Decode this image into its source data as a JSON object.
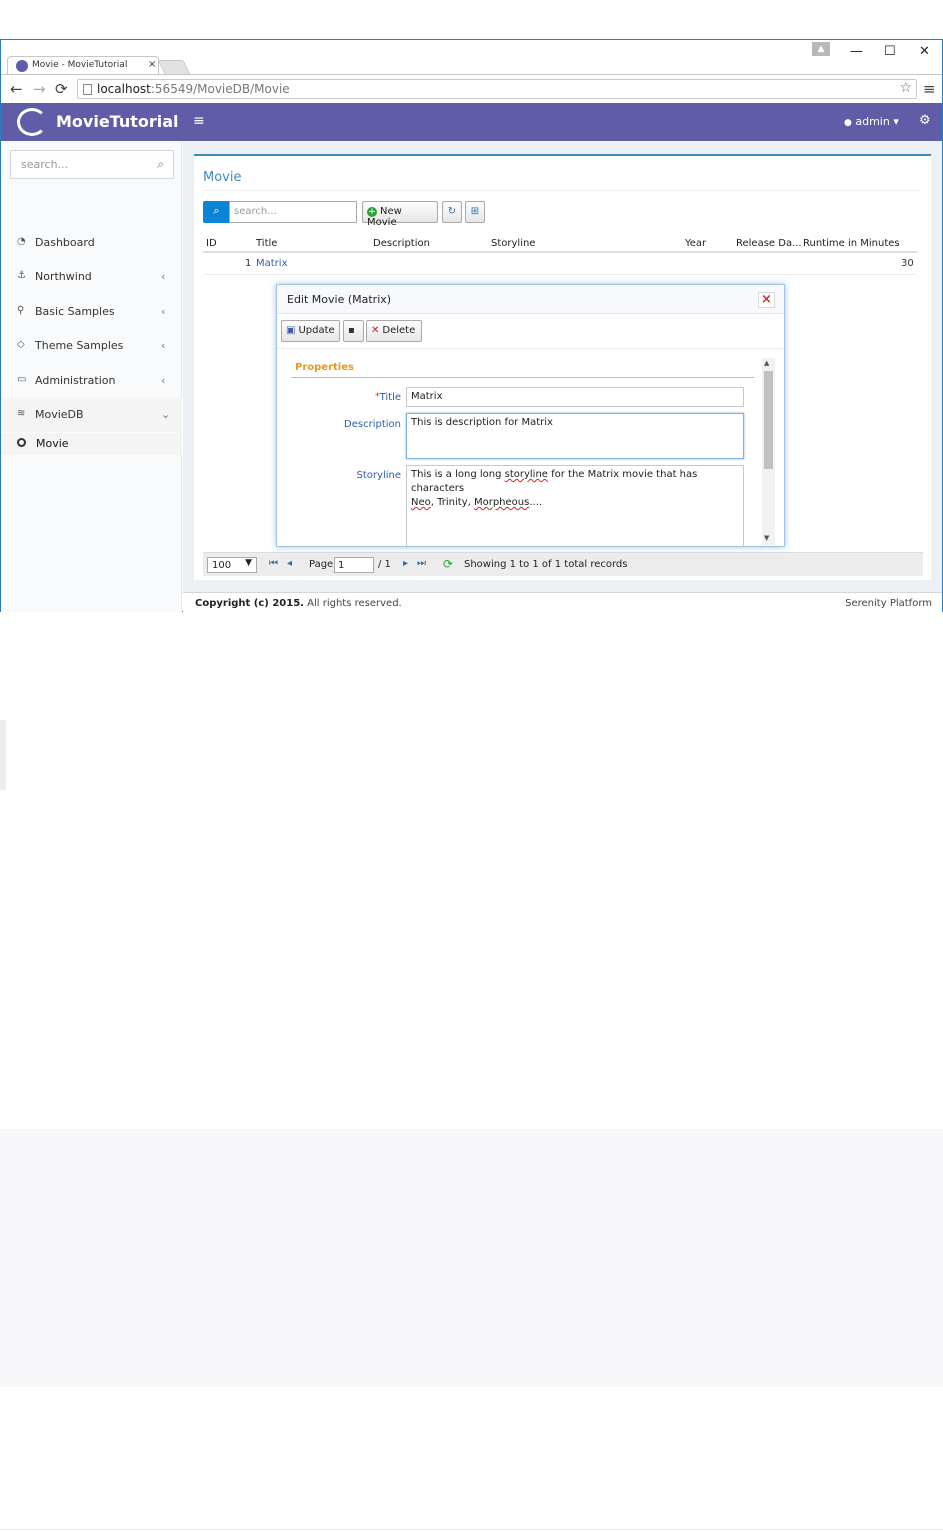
{
  "browser": {
    "tab_title": "Movie - MovieTutorial",
    "tab_close": "×",
    "url_host": "localhost",
    "url_path": ":56549/MovieDB/Movie",
    "user_icon": "person-icon",
    "minimize": "—",
    "maximize": "☐",
    "close": "✕",
    "back": "←",
    "forward": "→",
    "reload": "⟳",
    "star": "☆",
    "menu": "≡"
  },
  "app": {
    "logo_text": "MovieTutorial",
    "hamburger": "≡",
    "user_label": "admin ▾",
    "user_icon": "👤",
    "settings_icon": "⚙"
  },
  "sidebar": {
    "search_placeholder": "search...",
    "search_icon": "⌕",
    "items": [
      {
        "label": "Dashboard",
        "icon": "◔",
        "chevron": ""
      },
      {
        "label": "Northwind",
        "icon": "⚓",
        "chevron": "‹"
      },
      {
        "label": "Basic Samples",
        "icon": "⚲",
        "chevron": "‹"
      },
      {
        "label": "Theme Samples",
        "icon": "◇",
        "chevron": "‹"
      },
      {
        "label": "Administration",
        "icon": "▭",
        "chevron": "‹"
      },
      {
        "label": "MovieDB",
        "icon": "≋",
        "chevron": "⌄"
      }
    ],
    "sub_item": "Movie"
  },
  "main": {
    "title": "Movie",
    "search_placeholder": "search...",
    "search_icon": "🔍",
    "new_button": "New Movie",
    "new_icon": "+",
    "refresh_icon": "↻",
    "columns_icon": "⊞",
    "columns": [
      "ID",
      "Title",
      "Description",
      "Storyline",
      "Year",
      "Release Da...",
      "Runtime in Minutes"
    ],
    "rows": [
      {
        "id": "1",
        "title": "Matrix",
        "description": "",
        "storyline": "",
        "year": "",
        "release": "",
        "runtime": "30"
      }
    ],
    "pager": {
      "page_size": "100",
      "page_label": "Page",
      "page_value": "1",
      "page_of": "/ 1",
      "first": "⏮",
      "prev": "◂",
      "next": "▸",
      "last": "⏭",
      "refresh": "⟳",
      "status": "Showing 1 to 1 of 1 total records"
    }
  },
  "dialog": {
    "title": "Edit Movie (Matrix)",
    "close": "×",
    "update_label": "Update",
    "save_icon": "💾",
    "delete_label": "Delete",
    "category": "Properties",
    "fields": {
      "title_label": "Title",
      "title_required": "*",
      "title_value": "Matrix",
      "description_label": "Description",
      "description_value": "This is description for Matrix",
      "storyline_label": "Storyline",
      "storyline_line1_a": "This is a long long ",
      "storyline_line1_spell": "storyline",
      "storyline_line1_b": " for the Matrix movie that has characters",
      "storyline_line2_a": "Neo",
      "storyline_line2_b": ", Trinity, ",
      "storyline_line2_c": "Morpheous",
      "storyline_line2_d": "...."
    }
  },
  "footer": {
    "copyright_bold": "Copyright (c) 2015.",
    "copyright_rest": " All rights reserved.",
    "right": "Serenity Platform"
  }
}
